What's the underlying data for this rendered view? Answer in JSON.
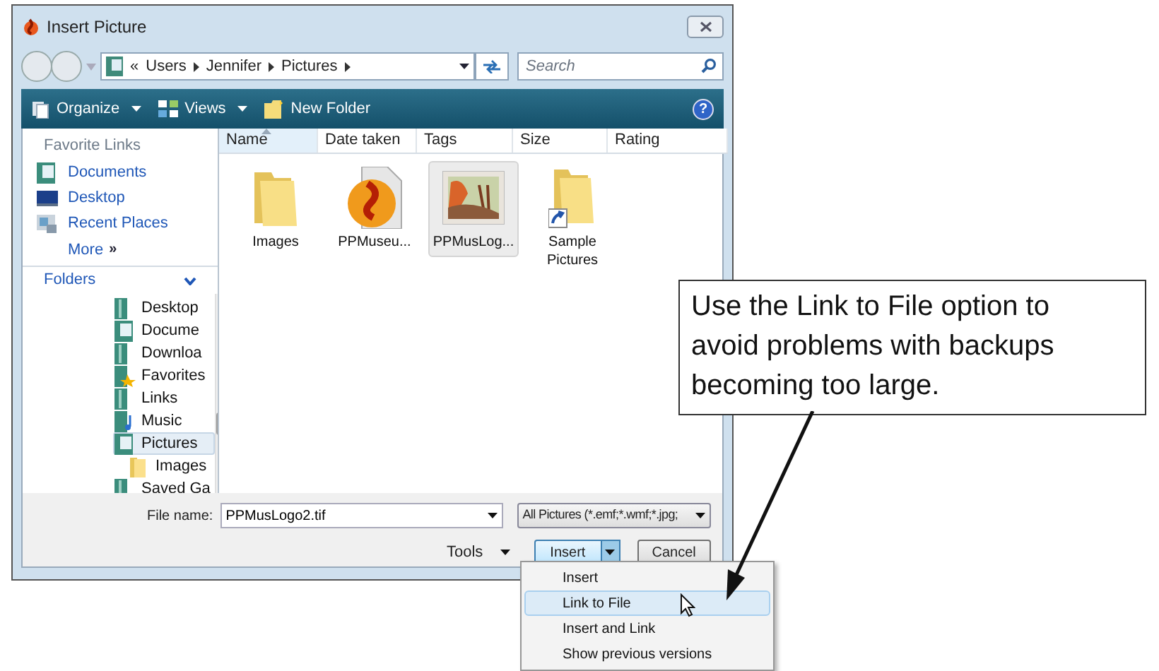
{
  "window": {
    "title": "Insert Picture"
  },
  "address": {
    "crumbs": [
      "«",
      "Users",
      "Jennifer",
      "Pictures"
    ]
  },
  "search": {
    "placeholder": "Search"
  },
  "help": {
    "glyph": "?"
  },
  "toolbar": [
    {
      "label": "Organize",
      "kind": "organize"
    },
    {
      "label": "Views",
      "kind": "views"
    },
    {
      "label": "New Folder",
      "kind": "folder"
    }
  ],
  "favorite_links": {
    "title": "Favorite Links",
    "items": [
      {
        "label": "Documents",
        "kind": "documents"
      },
      {
        "label": "Desktop",
        "kind": "desktop"
      },
      {
        "label": "Recent Places",
        "kind": "recent"
      }
    ],
    "more": "More",
    "more_glyph": "»"
  },
  "folders": {
    "title": "Folders",
    "items": [
      {
        "label": "Desktop",
        "kind": "library",
        "selected": false
      },
      {
        "label": "Docume",
        "kind": "documents",
        "selected": false
      },
      {
        "label": "Downloa",
        "kind": "library",
        "selected": false
      },
      {
        "label": "Favorites",
        "kind": "favorites",
        "selected": false
      },
      {
        "label": "Links",
        "kind": "library",
        "selected": false
      },
      {
        "label": "Music",
        "kind": "music",
        "selected": false
      },
      {
        "label": "Pictures",
        "kind": "documents",
        "selected": true,
        "children": [
          {
            "label": "Images",
            "kind": "folder",
            "selected": false
          }
        ]
      },
      {
        "label": "Saved Ga",
        "kind": "library",
        "selected": false
      }
    ]
  },
  "columns": [
    {
      "label": "Name",
      "sorted": true
    },
    {
      "label": "Date taken",
      "sorted": false
    },
    {
      "label": "Tags",
      "sorted": false
    },
    {
      "label": "Size",
      "sorted": false
    },
    {
      "label": "Rating",
      "sorted": false
    }
  ],
  "files": [
    {
      "name": "Images",
      "kind": "folder",
      "selected": false
    },
    {
      "name": "PPMuseu...",
      "kind": "app",
      "selected": false
    },
    {
      "name": "PPMusLog...",
      "kind": "image",
      "selected": true
    },
    {
      "name": "Sample Pictures",
      "kind": "shortcut",
      "selected": false
    }
  ],
  "file_name": {
    "label": "File name:",
    "value": "PPMusLogo2.tif"
  },
  "file_type": {
    "value": "All Pictures (*.emf;*.wmf;*.jpg;"
  },
  "tools": {
    "label": "Tools"
  },
  "buttons": {
    "insert": "Insert",
    "cancel": "Cancel"
  },
  "insert_menu": [
    {
      "label": "Insert",
      "selected": false
    },
    {
      "label": "Link to File",
      "selected": true
    },
    {
      "label": "Insert and Link",
      "selected": false
    },
    {
      "label": "Show previous versions",
      "selected": false
    }
  ],
  "callout": {
    "text": "Use the Link to File option to avoid problems with backups becoming too large."
  }
}
